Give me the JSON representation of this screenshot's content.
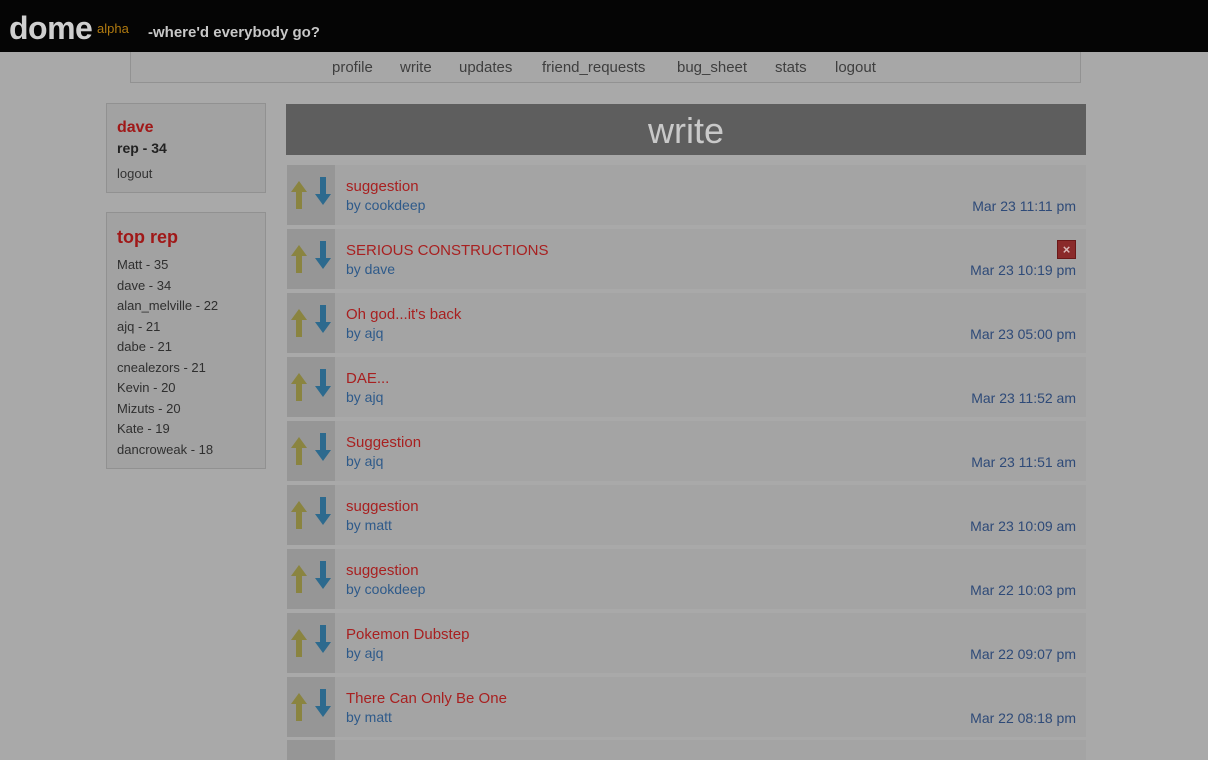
{
  "header": {
    "logo": "dome",
    "logo_sup": "alpha",
    "tagline": "-where'd everybody go?"
  },
  "nav": [
    "profile",
    "write",
    "updates",
    "friend_requests",
    "bug_sheet",
    "stats",
    "logout"
  ],
  "user_box": {
    "name": "dave",
    "rep": "rep - 34",
    "logout": "logout"
  },
  "top_rep": {
    "title": "top rep",
    "entries": [
      "Matt - 35",
      "dave - 34",
      "alan_melville - 22",
      "ajq - 21",
      "dabe - 21",
      "cnealezors - 21",
      "Kevin - 20",
      "Mizuts - 20",
      "Kate - 19",
      "dancroweak - 18"
    ]
  },
  "main": {
    "title": "write",
    "posts": [
      {
        "title": "suggestion",
        "author": "by cookdeep",
        "time": "Mar 23 11:11 pm",
        "deletable": false
      },
      {
        "title": "SERIOUS CONSTRUCTIONS",
        "author": "by dave",
        "time": "Mar 23 10:19 pm",
        "deletable": true,
        "delete_label": "×"
      },
      {
        "title": "Oh god...it's back",
        "author": "by ajq",
        "time": "Mar 23 05:00 pm",
        "deletable": false
      },
      {
        "title": "DAE...",
        "author": "by ajq",
        "time": "Mar 23 11:52 am",
        "deletable": false
      },
      {
        "title": "Suggestion",
        "author": "by ajq",
        "time": "Mar 23 11:51 am",
        "deletable": false
      },
      {
        "title": "suggestion",
        "author": "by matt",
        "time": "Mar 23 10:09 am",
        "deletable": false
      },
      {
        "title": "suggestion",
        "author": "by cookdeep",
        "time": "Mar 22 10:03 pm",
        "deletable": false
      },
      {
        "title": "Pokemon Dubstep",
        "author": "by ajq",
        "time": "Mar 22 09:07 pm",
        "deletable": false
      },
      {
        "title": "There Can Only Be One",
        "author": "by matt",
        "time": "Mar 22 08:18 pm",
        "deletable": false
      }
    ]
  },
  "colors": {
    "page_bg": "#a9a9a9",
    "topbar_bg": "#050505",
    "accent_red": "#a82020",
    "link_blue": "#2e5a8a",
    "up_arrow": "#8a8440",
    "down_arrow": "#2d6a8e"
  },
  "icons": {
    "upvote": "up-arrow-icon",
    "downvote": "down-arrow-icon",
    "delete": "close-icon"
  }
}
